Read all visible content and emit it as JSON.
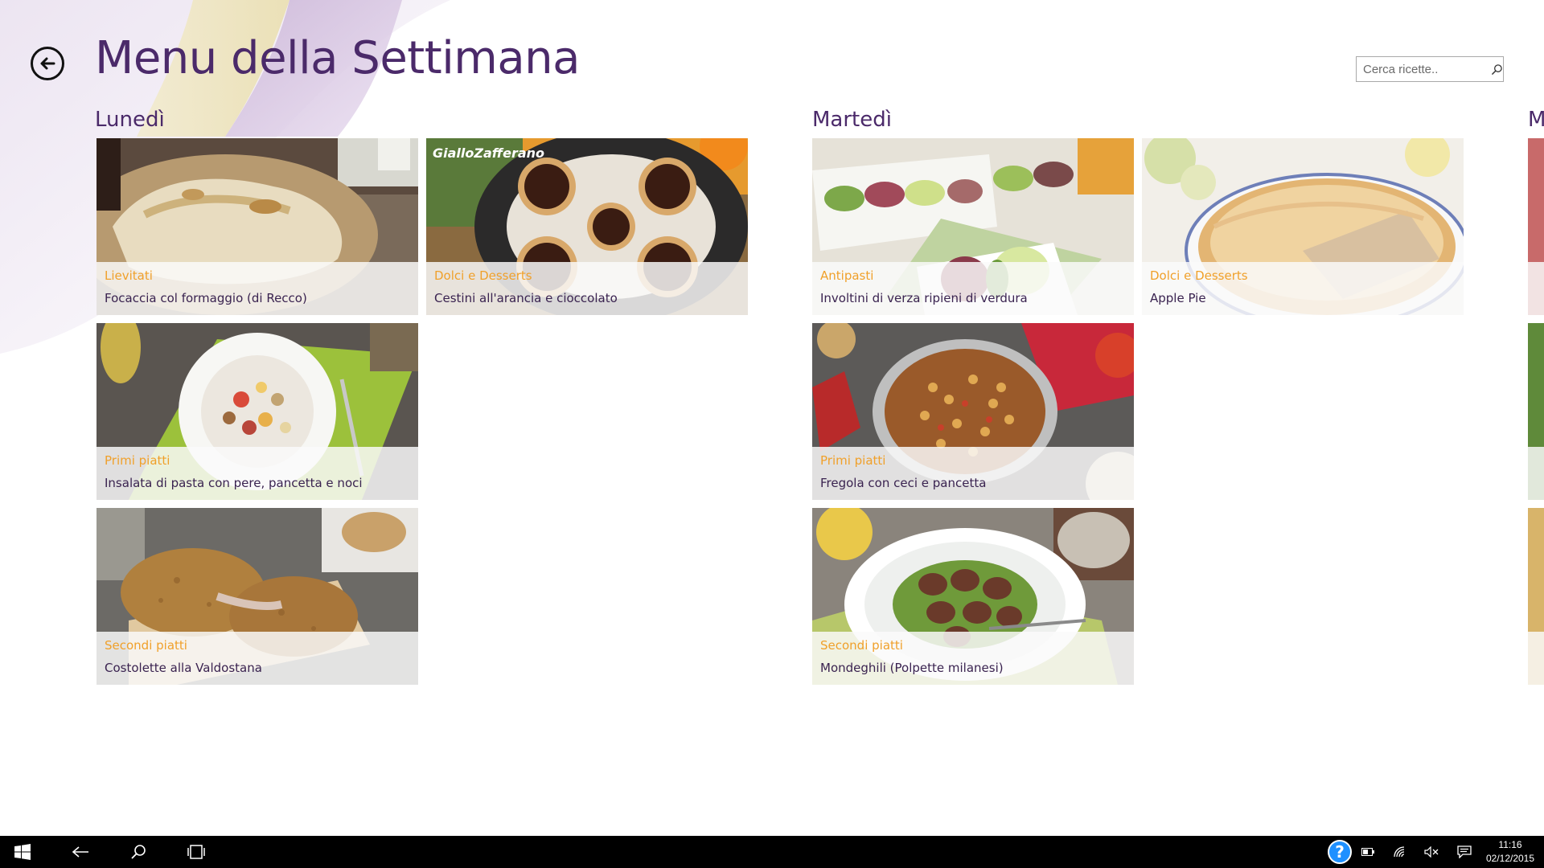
{
  "page": {
    "title": "Menu della Settimana",
    "back_label": "Indietro"
  },
  "search": {
    "placeholder": "Cerca ricette.."
  },
  "days": [
    {
      "name": "Lunedì",
      "recipes": [
        {
          "category": "Lievitati",
          "name": "Focaccia col formaggio (di Recco)",
          "image": "focaccia"
        },
        {
          "category": "Dolci e Desserts",
          "name": "Cestini all'arancia e cioccolato",
          "image": "cestini",
          "watermark": "GialloZafferano"
        },
        {
          "category": "Primi piatti",
          "name": "Insalata di pasta con pere, pancetta e noci",
          "image": "insalata-pasta"
        },
        {
          "category": "Secondi piatti",
          "name": "Costolette alla Valdostana",
          "image": "costolette"
        }
      ]
    },
    {
      "name": "Martedì",
      "recipes": [
        {
          "category": "Antipasti",
          "name": "Involtini di verza ripieni di verdura",
          "image": "involtini"
        },
        {
          "category": "Dolci e Desserts",
          "name": "Apple Pie",
          "image": "apple-pie"
        },
        {
          "category": "Primi piatti",
          "name": "Fregola con ceci e pancetta",
          "image": "fregola"
        },
        {
          "category": "Secondi piatti",
          "name": "Mondeghili (Polpette milanesi)",
          "image": "mondeghili"
        }
      ]
    },
    {
      "name": "M",
      "recipes": []
    }
  ],
  "colors": {
    "title": "#4b2a6a",
    "category": "#f0a02a",
    "recipe_name": "#3a2350",
    "taskbar": "#000000",
    "help_icon": "#1e90ff"
  },
  "taskbar": {
    "icons": [
      "windows-start-icon",
      "back-arrow-icon",
      "search-icon",
      "task-view-icon",
      "help-icon",
      "battery-icon",
      "wifi-icon",
      "volume-muted-icon",
      "action-center-icon"
    ],
    "time": "11:16",
    "date": "02/12/2015"
  }
}
